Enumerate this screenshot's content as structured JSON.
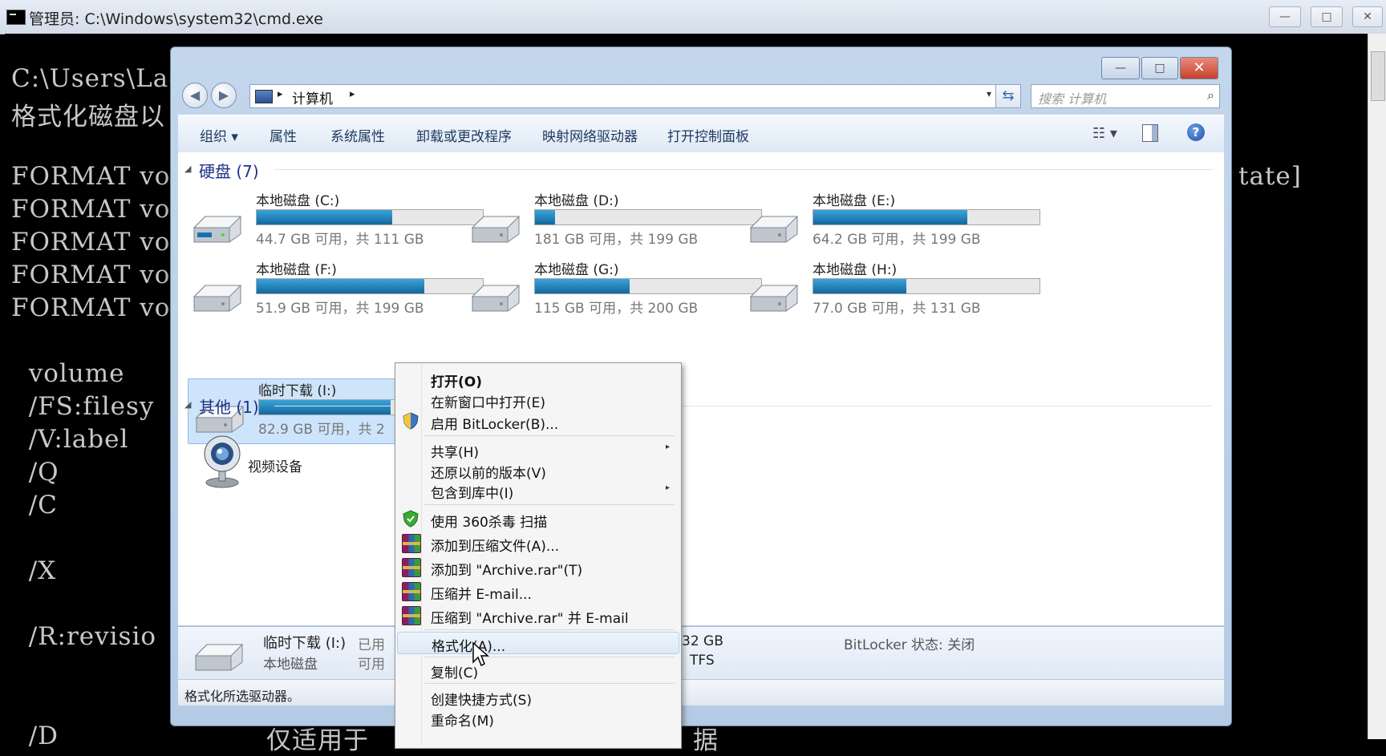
{
  "cmd": {
    "title": "管理员: C:\\Windows\\system32\\cmd.exe",
    "lines": [
      "C:\\Users\\Lac",
      "格式化磁盘以",
      "FORMAT volur",
      "FORMAT volur",
      "FORMAT volur",
      "FORMAT volur",
      "FORMAT volur",
      "  volume",
      "  /FS:filesy",
      "  /V:label",
      "  /Q",
      "  /C",
      "  /X",
      "  /R:revisio",
      "  /D",
      "仅适用于",
      "据"
    ],
    "right_fragment": "tate]",
    "controls": {
      "minimize": "—",
      "maximize": "□",
      "close": "✕"
    }
  },
  "explorer": {
    "controls": {
      "minimize": "—",
      "maximize": "□",
      "close": "✕"
    },
    "nav": {
      "back": "◀",
      "forward": "▶"
    },
    "address": {
      "location": "计算机",
      "arrow": "▸",
      "dropdown": "▾",
      "refresh": "⇆"
    },
    "search": {
      "placeholder": "搜索 计算机",
      "icon": "⌕"
    },
    "toolbar": {
      "items": [
        "组织 ▾",
        "属性",
        "系统属性",
        "卸载或更改程序",
        "映射网络驱动器",
        "打开控制面板"
      ],
      "view_icon": "☷ ▾",
      "help_icon": "?"
    },
    "groups": {
      "hard_disks": "硬盘 (7)",
      "other": "其他 (1)",
      "collapse_glyph": "◢"
    },
    "drives": [
      {
        "name": "本地磁盘 (C:)",
        "free": "44.7 GB 可用，共 111 GB",
        "used_fraction": 0.6
      },
      {
        "name": "本地磁盘 (D:)",
        "free": "181 GB 可用，共 199 GB",
        "used_fraction": 0.09
      },
      {
        "name": "本地磁盘 (E:)",
        "free": "64.2 GB 可用，共 199 GB",
        "used_fraction": 0.68
      },
      {
        "name": "本地磁盘 (F:)",
        "free": "51.9 GB 可用，共 199 GB",
        "used_fraction": 0.74
      },
      {
        "name": "本地磁盘 (G:)",
        "free": "115 GB 可用，共 200 GB",
        "used_fraction": 0.42
      },
      {
        "name": "本地磁盘 (H:)",
        "free": "77.0 GB 可用，共 131 GB",
        "used_fraction": 0.41
      },
      {
        "name": "临时下载 (I:)",
        "free": "82.9 GB 可用，共 2",
        "used_fraction": 0.58
      }
    ],
    "other_devices": [
      {
        "name": "视频设备"
      }
    ],
    "details": {
      "name": "临时下载 (I:)",
      "type": "本地磁盘",
      "used_label": "已用",
      "free_label": "可用",
      "size_fragment": "32 GB",
      "fs_fragment": "TFS",
      "bitlocker": "BitLocker 状态: 关闭"
    },
    "status": "格式化所选驱动器。"
  },
  "context_menu": {
    "items": [
      {
        "label": "打开(O)",
        "bold": true
      },
      {
        "label": "在新窗口中打开(E)"
      },
      {
        "label": "启用 BitLocker(B)...",
        "icon": "shield-icon"
      },
      {
        "label": "共享(H)",
        "submenu": true
      },
      {
        "label": "还原以前的版本(V)"
      },
      {
        "label": "包含到库中(I)",
        "submenu": true
      },
      {
        "label": "使用 360杀毒 扫描",
        "icon": "360-antivirus-icon"
      },
      {
        "label": "添加到压缩文件(A)...",
        "icon": "winrar-icon"
      },
      {
        "label": "添加到 \"Archive.rar\"(T)",
        "icon": "winrar-icon"
      },
      {
        "label": "压缩并 E-mail...",
        "icon": "winrar-icon"
      },
      {
        "label": "压缩到 \"Archive.rar\" 并 E-mail",
        "icon": "winrar-icon"
      },
      {
        "label": "格式化(A)...",
        "highlighted": true
      },
      {
        "label": "复制(C)"
      },
      {
        "label": "创建快捷方式(S)"
      },
      {
        "label": "重命名(M)"
      }
    ],
    "submenu_arrow": "▸"
  },
  "colors": {
    "cmd_bg": "#000000",
    "cmd_text": "#c8c8c8",
    "drive_bar": "#1e80bd",
    "group_header": "#1e3287",
    "close_button": "#c8402b",
    "selection": "#cde4fb"
  }
}
